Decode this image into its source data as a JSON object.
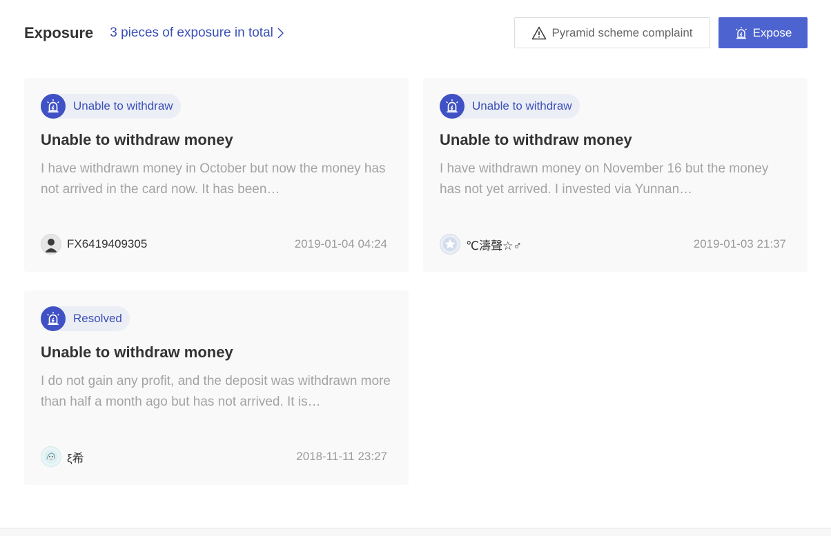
{
  "header": {
    "title": "Exposure",
    "total_link": "3 pieces of exposure in total",
    "complaint_button": "Pyramid scheme complaint",
    "expose_button": "Expose"
  },
  "colors": {
    "accent": "#4c63d0",
    "tag_icon_bg": "#3f51c4",
    "link": "#3a4fb5"
  },
  "cards": [
    {
      "tag": "Unable to withdraw",
      "title": "Unable to withdraw money",
      "description": "I have withdrawn money in October but now the money has not arrived in the card now. It has been…",
      "user": "FX6419409305",
      "time": "2019-01-04 04:24",
      "avatar_icon": "person-avatar-icon"
    },
    {
      "tag": "Unable to withdraw",
      "title": "Unable to withdraw money",
      "description": "I have withdrawn money on November 16 but the money has not yet arrived. I invested via Yunnan…",
      "user": "℃濤聲☆♂",
      "time": "2019-01-03 21:37",
      "avatar_icon": "star-avatar-icon"
    },
    {
      "tag": "Resolved",
      "title": "Unable to withdraw money",
      "description": "I do not gain any profit, and the deposit was withdrawn more than half a month ago but has not arrived. It is…",
      "user": "ξ希",
      "time": "2018-11-11 23:27",
      "avatar_icon": "cartoon-avatar-icon"
    }
  ]
}
